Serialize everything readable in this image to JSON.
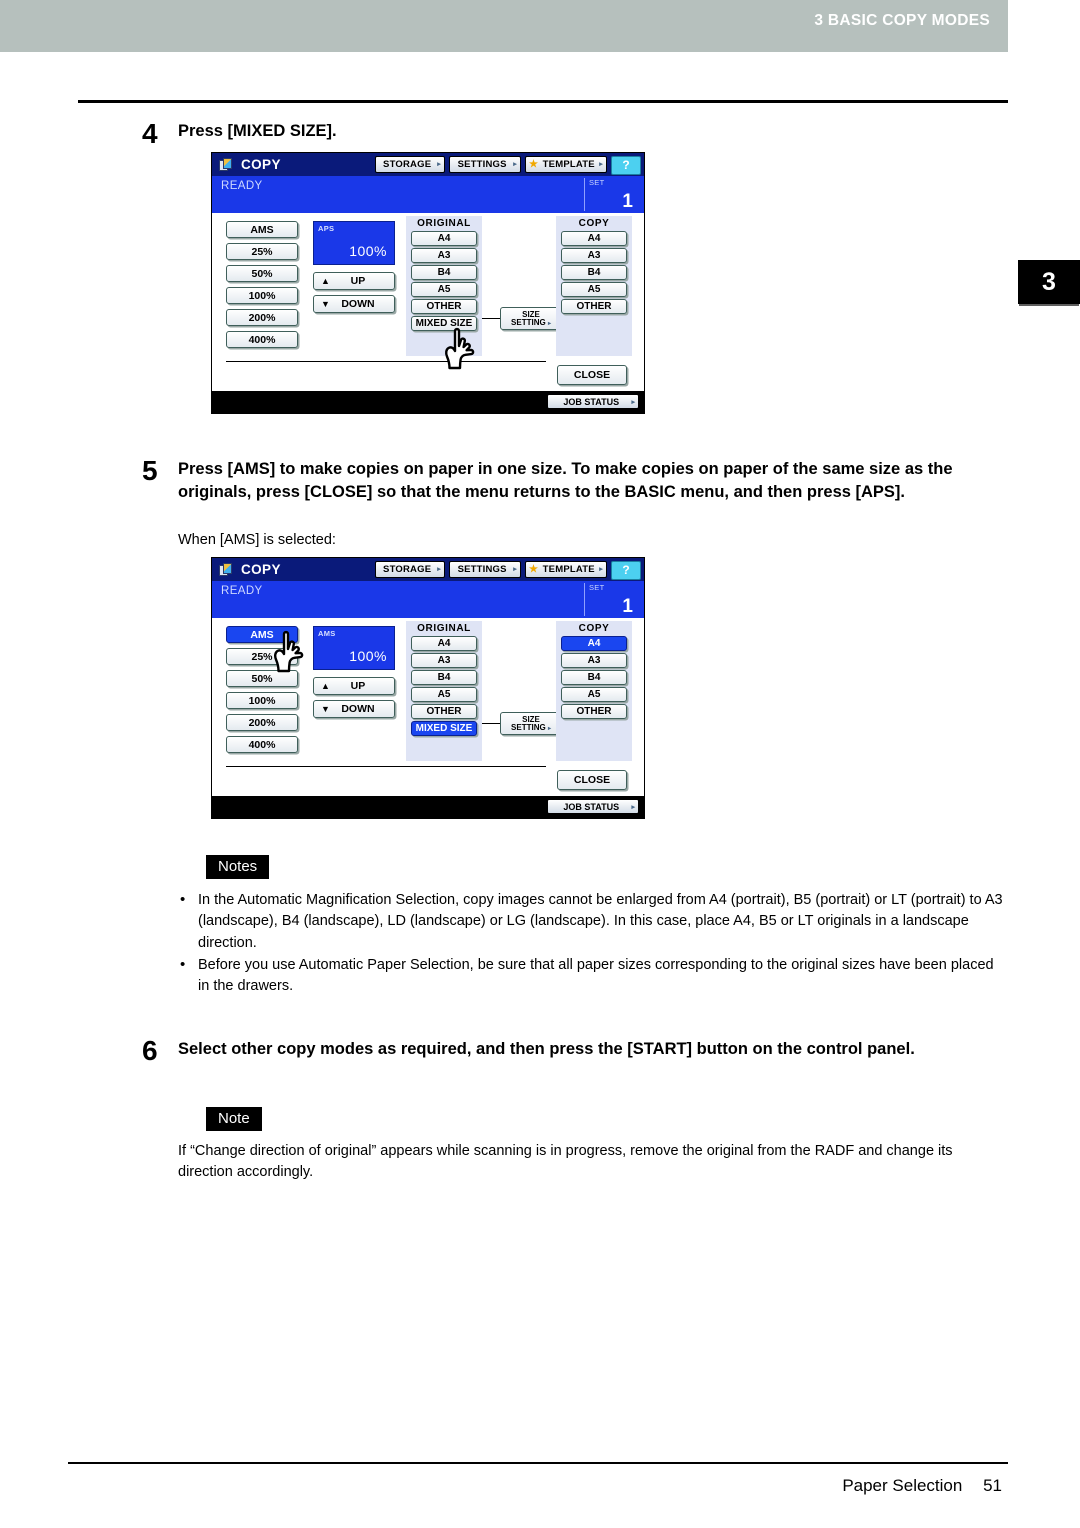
{
  "page": {
    "header_title": "3 BASIC COPY MODES",
    "chapter_tab": "3",
    "footer_section": "Paper Selection",
    "footer_page": "51"
  },
  "steps": [
    {
      "number": "4",
      "text": "Press [MIXED SIZE]."
    },
    {
      "number": "5",
      "text": "Press [AMS] to make copies on paper in one size. To make copies on paper of the same size as the originals, press [CLOSE] so that the menu returns to the BASIC menu, and then press [APS].",
      "caption": "When [AMS] is selected:"
    },
    {
      "number": "6",
      "text": "Select other copy modes as required, and then press the [START] button on the control panel."
    }
  ],
  "notes_block": {
    "badge": "Notes",
    "items": [
      "In the Automatic Magnification Selection, copy images cannot be enlarged from A4 (portrait), B5 (portrait) or LT (portrait) to A3 (landscape), B4 (landscape), LD (landscape) or LG (landscape). In this case, place A4, B5 or LT originals in a landscape direction.",
      "Before you use Automatic Paper Selection, be sure that all paper sizes corresponding to the original sizes have been placed in the drawers."
    ]
  },
  "note_block": {
    "badge": "Note",
    "text": "If “Change direction of original” appears while scanning is in progress, remove the original from the RADF and change its direction accordingly."
  },
  "lcd_common": {
    "app_title": "COPY",
    "toolbar": [
      {
        "label": "STORAGE",
        "arrow": "▸",
        "star": false
      },
      {
        "label": "SETTINGS",
        "arrow": "▸",
        "star": false
      },
      {
        "label": "TEMPLATE",
        "arrow": "▸",
        "star": true
      }
    ],
    "help_label": "?",
    "status": "READY",
    "set_label": "SET",
    "set_value": "1",
    "ratio_buttons": [
      "AMS",
      "25%",
      "50%",
      "100%",
      "200%",
      "400%"
    ],
    "up_label": "UP",
    "down_label": "DOWN",
    "original_header": "ORIGINAL",
    "copy_header": "COPY",
    "original_sizes": [
      "A4",
      "A3",
      "B4",
      "A5",
      "OTHER",
      "MIXED SIZE"
    ],
    "copy_sizes": [
      "A4",
      "A3",
      "B4",
      "A5",
      "OTHER"
    ],
    "size_setting_line1": "SIZE",
    "size_setting_line2": "SETTING",
    "size_setting_arrow": "▸",
    "close_label": "CLOSE",
    "job_status_label": "JOB STATUS",
    "job_status_arrow": "▸",
    "zoom_percent": "100%"
  },
  "lcd_panel_1": {
    "zoom_mode_label": "APS",
    "selected_ratio": null,
    "selected_original": null,
    "selected_copy": null
  },
  "lcd_panel_2": {
    "zoom_mode_label": "AMS",
    "selected_ratio": "AMS",
    "selected_original": "MIXED SIZE",
    "selected_copy": "A4"
  },
  "colors": {
    "header_band": "#b6c0bd",
    "lcd_title_bg": "#0a1a7a",
    "lcd_status_bg": "#1a38e8",
    "selection_blue": "#1a46f0",
    "size_column_bg": "#dfe4f5",
    "help_cyan": "#4cd0f0"
  }
}
